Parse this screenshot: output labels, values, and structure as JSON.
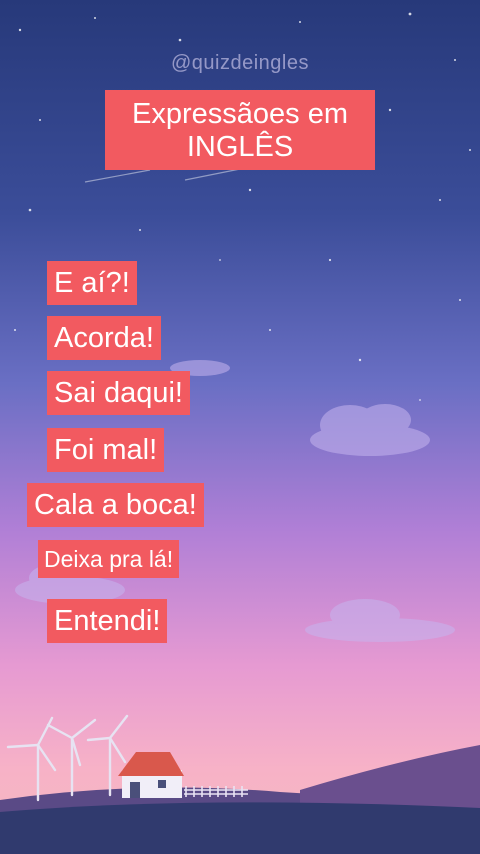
{
  "header": {
    "handle": "@quizdeingles",
    "title_line1": "Expressãoes em",
    "title_line2": "INGLÊS"
  },
  "phrases": [
    "E aí?!",
    "Acorda!",
    "Sai daqui!",
    "Foi mal!",
    "Cala a boca!",
    "Deixa pra lá!",
    "Entendi!"
  ],
  "colors": {
    "label_background": "#f25a60",
    "label_text": "#ffffff",
    "sky_top": "#2a3d7c",
    "sky_bottom": "#f4a6c8"
  }
}
